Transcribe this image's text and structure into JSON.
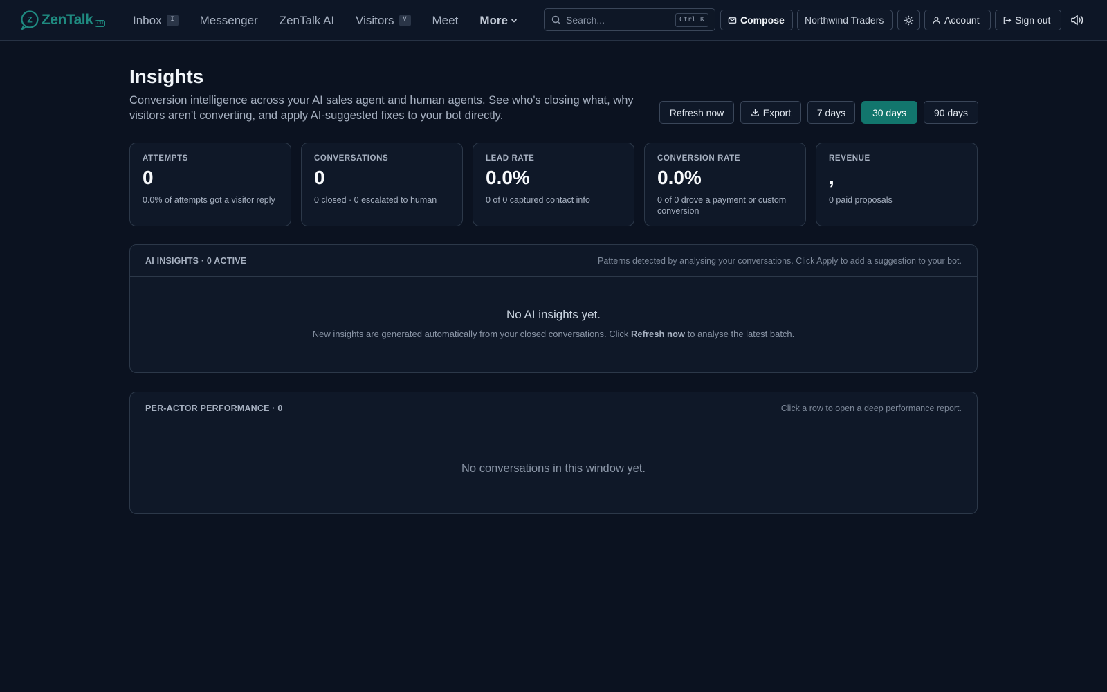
{
  "app": {
    "logo_text": "ZenTalk",
    "logo_badge": "CO",
    "accent": "#12766d",
    "background": "#0b1220"
  },
  "nav": {
    "items": [
      {
        "label": "Inbox",
        "shortcut": "I"
      },
      {
        "label": "Messenger",
        "shortcut": ""
      },
      {
        "label": "ZenTalk AI",
        "shortcut": ""
      },
      {
        "label": "Visitors",
        "shortcut": "V"
      },
      {
        "label": "Meet",
        "shortcut": ""
      }
    ],
    "more_label": "More"
  },
  "search": {
    "placeholder": "Search...",
    "shortcut": "Ctrl K"
  },
  "toolbar": {
    "compose_label": "Compose",
    "org_label": "Northwind Traders",
    "account_label": "Account",
    "signout_label": "Sign out"
  },
  "page": {
    "title": "Insights",
    "description": "Conversion intelligence across your AI sales agent and human agents. See who's closing what, why visitors aren't converting, and apply AI-suggested fixes to your bot directly.",
    "actions": {
      "refresh_label": "Refresh now",
      "export_label": "Export",
      "ranges": [
        "7 days",
        "30 days",
        "90 days"
      ],
      "selected_range": "30 days"
    }
  },
  "kpis": [
    {
      "label": "ATTEMPTS",
      "value": "0",
      "sub": "0.0% of attempts got a visitor reply"
    },
    {
      "label": "CONVERSATIONS",
      "value": "0",
      "sub": "0 closed · 0 escalated to human"
    },
    {
      "label": "LEAD RATE",
      "value": "0.0%",
      "sub": "0 of 0 captured contact info"
    },
    {
      "label": "CONVERSION RATE",
      "value": "0.0%",
      "sub": "0 of 0 drove a payment or custom conversion"
    },
    {
      "label": "REVENUE",
      "value": ",",
      "sub": "0 paid proposals"
    }
  ],
  "ai_insights": {
    "title": "AI INSIGHTS · 0 ACTIVE",
    "hint": "Patterns detected by analysing your conversations. Click Apply to add a suggestion to your bot.",
    "empty_title": "No AI insights yet.",
    "empty_sub_pre": "New insights are generated automatically from your closed conversations. Click ",
    "empty_sub_bold": "Refresh now",
    "empty_sub_post": " to analyse the latest batch."
  },
  "performance": {
    "title": "PER-ACTOR PERFORMANCE · 0",
    "hint": "Click a row to open a deep performance report.",
    "empty": "No conversations in this window yet."
  }
}
